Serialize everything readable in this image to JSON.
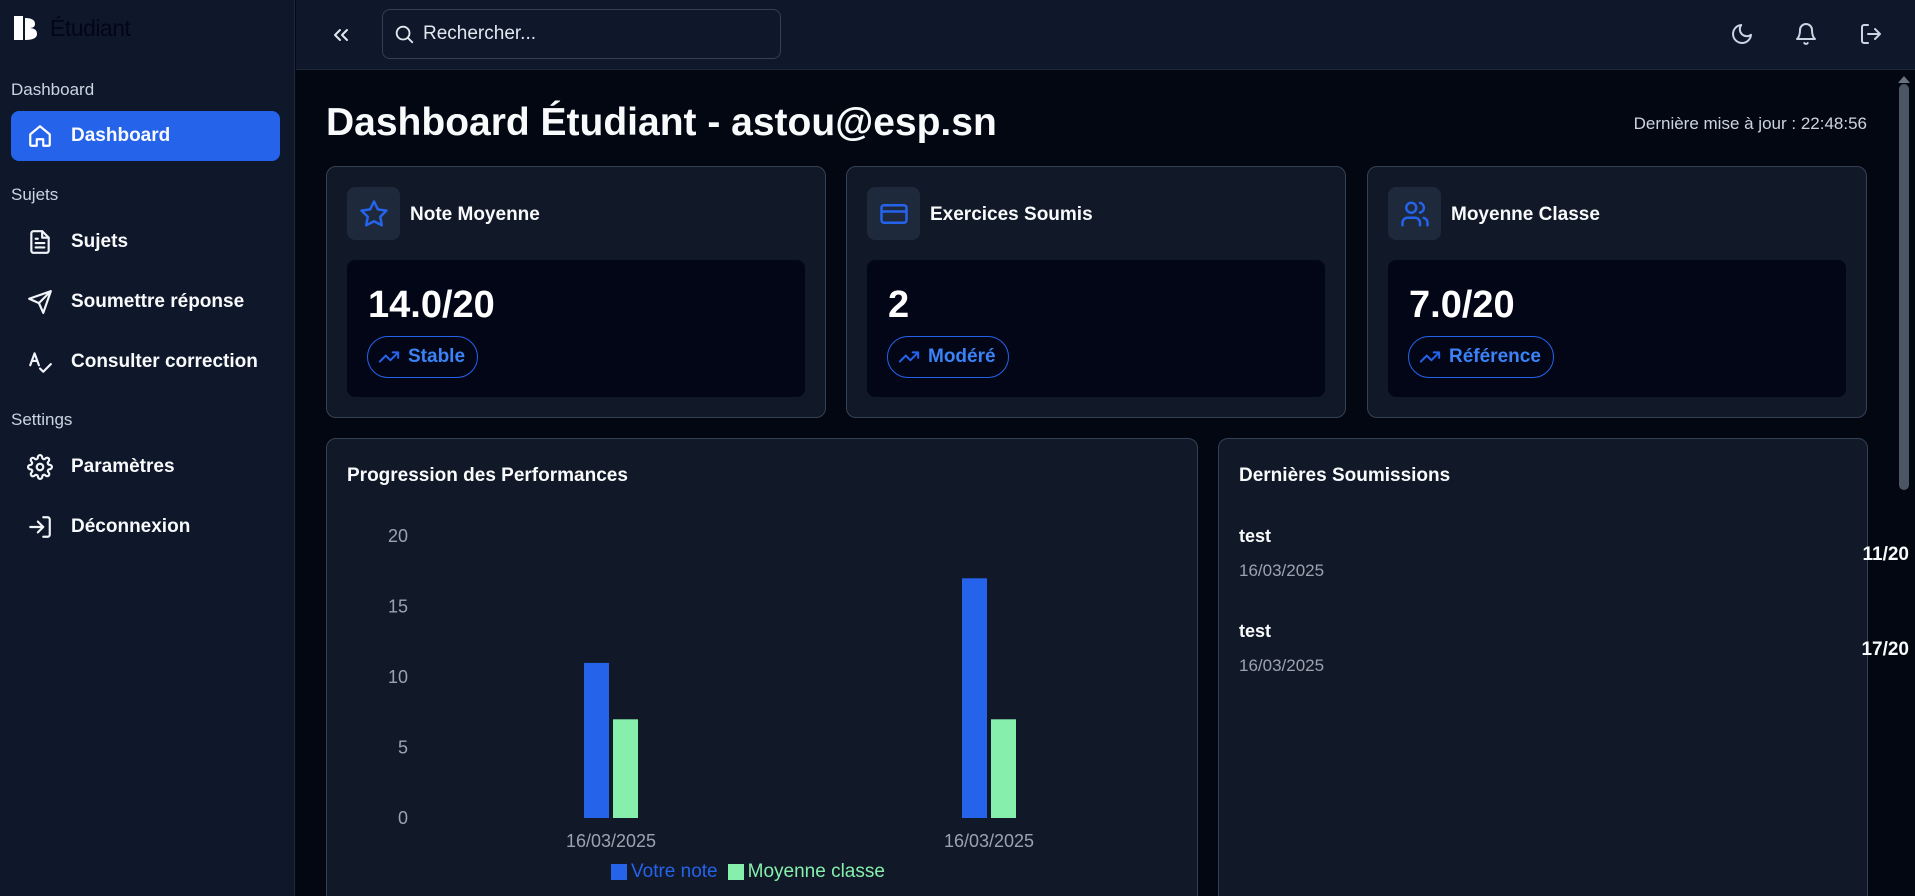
{
  "app": {
    "brand_name": "Étudiant"
  },
  "sidebar": {
    "groups": [
      {
        "label": "Dashboard",
        "items": [
          {
            "label": "Dashboard",
            "icon": "home-icon",
            "active": true
          }
        ]
      },
      {
        "label": "Sujets",
        "items": [
          {
            "label": "Sujets",
            "icon": "file-text-icon"
          },
          {
            "label": "Soumettre réponse",
            "icon": "send-icon"
          },
          {
            "label": "Consulter correction",
            "icon": "spell-check-icon"
          }
        ]
      },
      {
        "label": "Settings",
        "items": [
          {
            "label": "Paramètres",
            "icon": "gear-icon"
          },
          {
            "label": "Déconnexion",
            "icon": "logout-icon"
          }
        ]
      }
    ]
  },
  "topbar": {
    "search_placeholder": "Rechercher...",
    "icons": [
      "collapse-sidebar-icon",
      "moon-icon",
      "bell-icon",
      "logout-icon"
    ]
  },
  "header": {
    "title": "Dashboard Étudiant - astou@esp.sn",
    "last_update": "Dernière mise à jour : 22:48:56"
  },
  "stats": [
    {
      "label": "Note Moyenne",
      "value": "14.0/20",
      "badge": "Stable",
      "icon": "star-icon"
    },
    {
      "label": "Exercices Soumis",
      "value": "2",
      "badge": "Modéré",
      "icon": "credit-card-icon"
    },
    {
      "label": "Moyenne Classe",
      "value": "7.0/20",
      "badge": "Référence",
      "icon": "users-icon"
    }
  ],
  "performance": {
    "title": "Progression des Performances"
  },
  "chart_data": {
    "type": "bar",
    "title": "Progression des Performances",
    "categories": [
      "16/03/2025",
      "16/03/2025"
    ],
    "series": [
      {
        "name": "Votre note",
        "values": [
          11,
          17
        ],
        "color": "#2563eb"
      },
      {
        "name": "Moyenne classe",
        "values": [
          7,
          7
        ],
        "color": "#86efac"
      }
    ],
    "yticks": [
      0,
      5,
      10,
      15,
      20
    ],
    "ylim": [
      0,
      20
    ],
    "xlabel": "",
    "ylabel": "",
    "legend": "bottom-center",
    "grid": false
  },
  "submissions": {
    "title": "Dernières Soumissions",
    "items": [
      {
        "name": "test",
        "date": "16/03/2025",
        "score": "11/20"
      },
      {
        "name": "test",
        "date": "16/03/2025",
        "score": "17/20"
      }
    ]
  },
  "colors": {
    "accent": "#2563eb",
    "bg": "#030712",
    "panel": "#111827",
    "sidebar": "#0f172a"
  }
}
